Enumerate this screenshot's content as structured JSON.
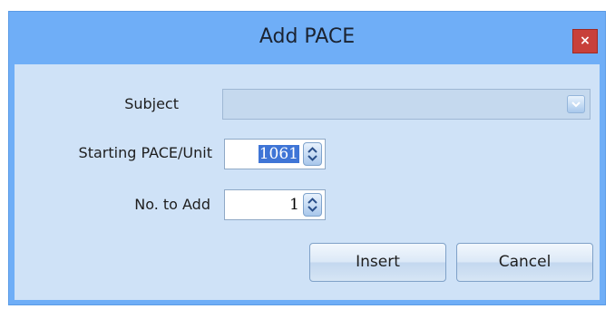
{
  "window": {
    "title": "Add PACE",
    "close_label": "×"
  },
  "form": {
    "subject": {
      "label": "Subject",
      "value": ""
    },
    "starting_pace": {
      "label": "Starting PACE/Unit",
      "value": "1061"
    },
    "no_to_add": {
      "label": "No. to Add",
      "value": "1"
    }
  },
  "buttons": {
    "insert": "Insert",
    "cancel": "Cancel"
  },
  "icons": {
    "combo_arrow": "chevron-down-icon",
    "spinner": "spin-up-down-icon"
  },
  "colors": {
    "title_bar": "#6faef7",
    "client_area": "#cfe2f7",
    "close_button": "#c8403a",
    "selection": "#3f75d6"
  }
}
